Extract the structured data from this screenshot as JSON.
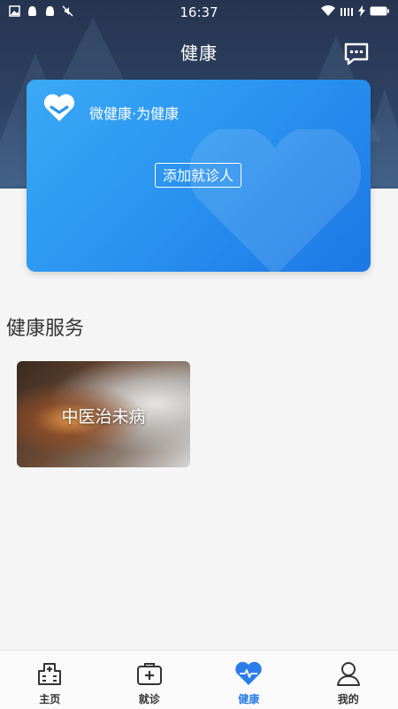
{
  "status_bar": {
    "time": "16:37"
  },
  "header": {
    "title": "健康"
  },
  "card": {
    "slogan": "微健康·为健康",
    "add_button": "添加就诊人"
  },
  "section": {
    "title": "健康服务"
  },
  "services": [
    {
      "label": "中医治未病"
    }
  ],
  "tabs": [
    {
      "label": "主页",
      "icon": "hospital-icon"
    },
    {
      "label": "就诊",
      "icon": "medical-kit-icon"
    },
    {
      "label": "健康",
      "icon": "heart-pulse-icon",
      "active": true
    },
    {
      "label": "我的",
      "icon": "user-icon"
    }
  ],
  "colors": {
    "accent": "#2b7de9",
    "card_start": "#3aa9f5",
    "card_end": "#1b78e5",
    "header": "#2d4263"
  }
}
